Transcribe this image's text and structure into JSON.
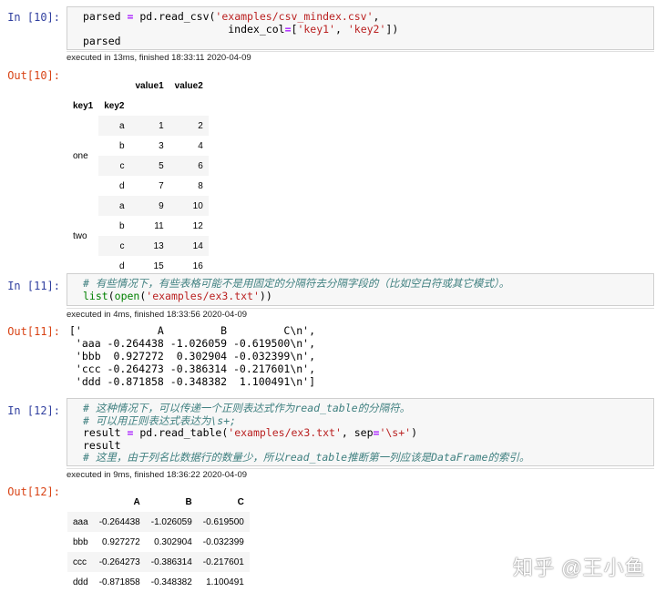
{
  "cell10": {
    "in_prompt": "In [10]:",
    "code": [
      [
        [
          "",
          "parsed "
        ],
        [
          "o",
          "="
        ],
        [
          "",
          " pd.read_csv("
        ],
        [
          "s",
          "'examples/csv_mindex.csv'"
        ],
        [
          "",
          ","
        ]
      ],
      [
        [
          "",
          "                       index_col"
        ],
        [
          "o",
          "="
        ],
        [
          "",
          "["
        ],
        [
          "s",
          "'key1'"
        ],
        [
          "",
          ", "
        ],
        [
          "s",
          "'key2'"
        ],
        [
          "",
          "])"
        ]
      ],
      [
        [
          "",
          "parsed"
        ]
      ]
    ],
    "exec": "executed in 13ms, finished 18:33:11 2020-04-09",
    "out_prompt": "Out[10]:",
    "table": {
      "columns": [
        "value1",
        "value2"
      ],
      "index_names": [
        "key1",
        "key2"
      ],
      "groups": [
        {
          "key1": "one",
          "rows": [
            [
              "a",
              "1",
              "2"
            ],
            [
              "b",
              "3",
              "4"
            ],
            [
              "c",
              "5",
              "6"
            ],
            [
              "d",
              "7",
              "8"
            ]
          ]
        },
        {
          "key1": "two",
          "rows": [
            [
              "a",
              "9",
              "10"
            ],
            [
              "b",
              "11",
              "12"
            ],
            [
              "c",
              "13",
              "14"
            ],
            [
              "d",
              "15",
              "16"
            ]
          ]
        }
      ]
    }
  },
  "cell11": {
    "in_prompt": "In [11]:",
    "code": [
      [
        [
          "c",
          "# 有些情况下，有些表格可能不是用固定的分隔符去分隔字段的（比如空白符或其它模式）。"
        ]
      ],
      [
        [
          "b",
          "list"
        ],
        [
          "",
          "("
        ],
        [
          "b",
          "open"
        ],
        [
          "",
          "("
        ],
        [
          "s",
          "'examples/ex3.txt'"
        ],
        [
          "",
          "))"
        ]
      ]
    ],
    "exec": "executed in 4ms, finished 18:33:56 2020-04-09",
    "out_prompt": "Out[11]:",
    "output": [
      "['            A         B         C\\n',",
      " 'aaa -0.264438 -1.026059 -0.619500\\n',",
      " 'bbb  0.927272  0.302904 -0.032399\\n',",
      " 'ccc -0.264273 -0.386314 -0.217601\\n',",
      " 'ddd -0.871858 -0.348382  1.100491\\n']"
    ]
  },
  "cell12": {
    "in_prompt": "In [12]:",
    "code": [
      [
        [
          "c",
          "# 这种情况下，可以传递一个正则表达式作为read_table的分隔符。"
        ]
      ],
      [
        [
          "c",
          "# 可以用正则表达式表达为\\s+;"
        ]
      ],
      [
        [
          "",
          "result "
        ],
        [
          "o",
          "="
        ],
        [
          "",
          " pd.read_table("
        ],
        [
          "s",
          "'examples/ex3.txt'"
        ],
        [
          "",
          ", sep"
        ],
        [
          "o",
          "="
        ],
        [
          "s",
          "'\\s+'"
        ],
        [
          "",
          ")"
        ]
      ],
      [
        [
          "",
          "result"
        ]
      ],
      [
        [
          "c",
          "# 这里，由于列名比数据行的数量少，所以read_table推断第一列应该是DataFrame的索引。"
        ]
      ]
    ],
    "exec": "executed in 9ms, finished 18:36:22 2020-04-09",
    "out_prompt": "Out[12]:",
    "table": {
      "columns": [
        "A",
        "B",
        "C"
      ],
      "rows": [
        [
          "aaa",
          "-0.264438",
          "-1.026059",
          "-0.619500"
        ],
        [
          "bbb",
          "0.927272",
          "0.302904",
          "-0.032399"
        ],
        [
          "ccc",
          "-0.264273",
          "-0.386314",
          "-0.217601"
        ],
        [
          "ddd",
          "-0.871858",
          "-0.348382",
          "1.100491"
        ]
      ]
    }
  },
  "watermark": "知乎 @王小鱼"
}
